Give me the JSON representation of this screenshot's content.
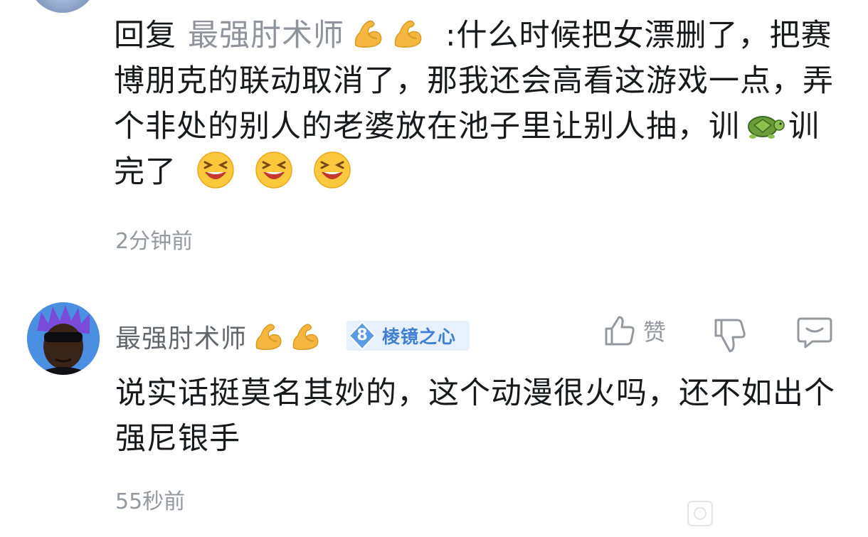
{
  "reply": {
    "prefix": "回复",
    "target_user": "最强肘术师",
    "target_emojis": [
      "flexed-biceps-emoji",
      "flexed-biceps-emoji"
    ],
    "colon": ":",
    "text_part1": "什么时候把女漂删了，把赛博朋克的联动取消了，那我还会高看这游戏一点，弄个非处的别人的老婆放在池子里让别人抽，训",
    "text_emoji_mid": "turtle-emoji",
    "text_part2": "训完了",
    "trailing_emojis": [
      "grinning-squinting-face-emoji",
      "grinning-squinting-face-emoji",
      "grinning-squinting-face-emoji"
    ],
    "time": "2分钟前"
  },
  "comment": {
    "username": "最强肘术师",
    "username_emojis": [
      "flexed-biceps-emoji",
      "flexed-biceps-emoji"
    ],
    "fan_badge": {
      "level": "8",
      "name": "棱镜之心",
      "color": "#3f7fd5",
      "bg": "#e7f1fd"
    },
    "actions": {
      "like_label": "赞",
      "like_icon": "thumbs-up-icon",
      "dislike_icon": "thumbs-down-icon",
      "reply_icon": "comment-bubble-icon"
    },
    "text": "说实话挺莫名其妙的，这个动漫很火吗，还不如出个强尼银手",
    "time": "55秒前"
  },
  "colors": {
    "text_primary": "#18191c",
    "text_secondary": "#61666d",
    "text_tertiary": "#9499a0",
    "reply_target": "#8f939c",
    "badge_blue": "#4a8fe1"
  }
}
